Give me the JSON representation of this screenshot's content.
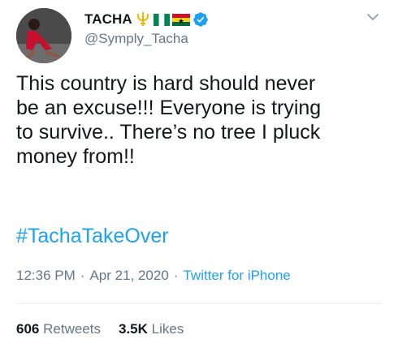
{
  "user": {
    "display_name": "TACHA",
    "handle": "@Symply_Tacha",
    "name_emoji": [
      "trident-emoji",
      "nigeria-flag",
      "ghana-flag"
    ],
    "verified": true
  },
  "tweet": {
    "text": "This country is hard should never\nbe an excuse!!! Everyone is trying\nto survive.. There’s no tree I pluck\nmoney from!!",
    "hashtag": "#TachaTakeOver"
  },
  "meta": {
    "time": "12:36 PM",
    "date": "Apr 21, 2020",
    "separator": "·",
    "source": "Twitter for iPhone"
  },
  "stats": {
    "retweets_count": "606",
    "retweets_label": "Retweets",
    "likes_count": "3.5K",
    "likes_label": "Likes"
  },
  "colors": {
    "link": "#1da1f2",
    "secondary_text": "#657786",
    "primary_text": "#14171a",
    "divider": "#e6ecf0"
  }
}
